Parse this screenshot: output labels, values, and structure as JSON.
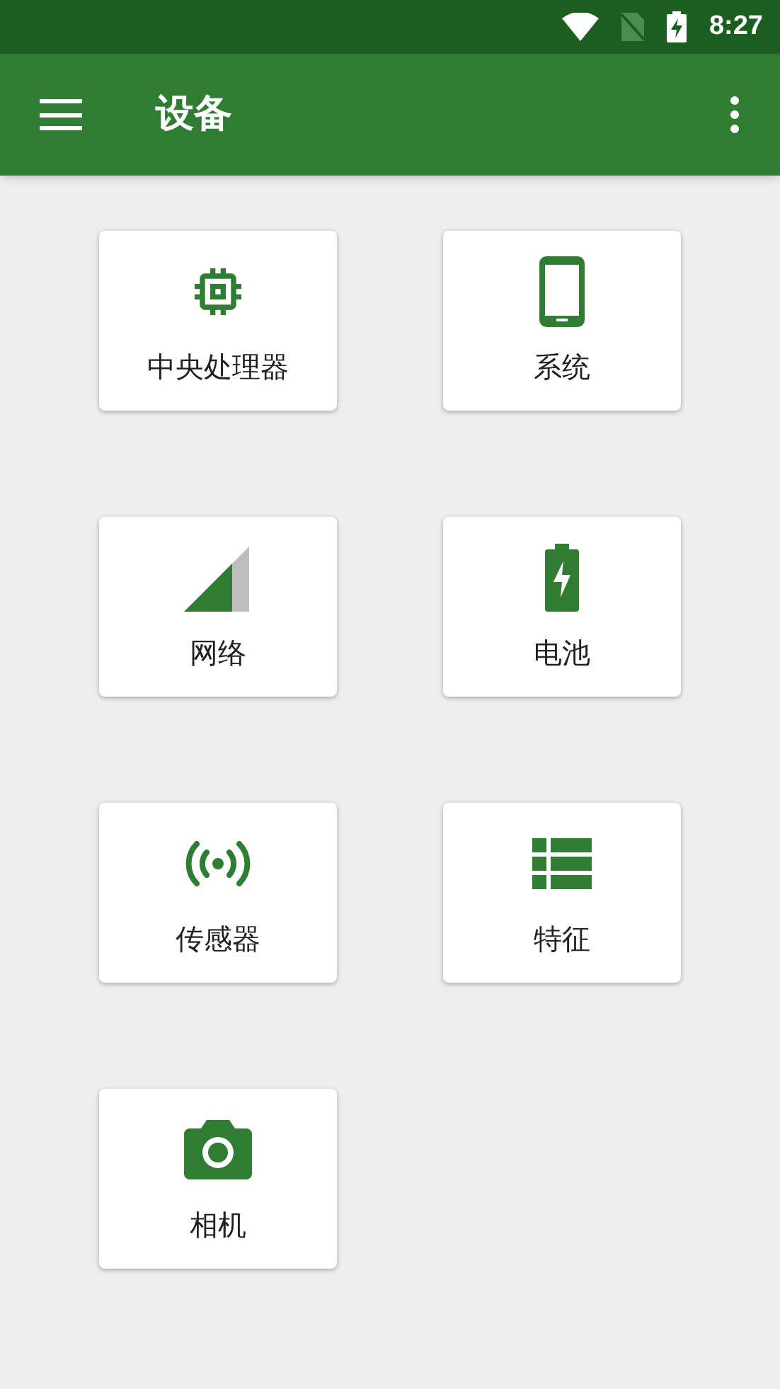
{
  "status_bar": {
    "time": "8:27"
  },
  "app_bar": {
    "title": "设备"
  },
  "tiles": [
    {
      "kind": "cpu",
      "label": "中央处理器"
    },
    {
      "kind": "phone",
      "label": "系统"
    },
    {
      "kind": "signal",
      "label": "网络"
    },
    {
      "kind": "battery",
      "label": "电池"
    },
    {
      "kind": "sensor",
      "label": "传感器"
    },
    {
      "kind": "list",
      "label": "特征"
    },
    {
      "kind": "camera",
      "label": "相机"
    }
  ]
}
